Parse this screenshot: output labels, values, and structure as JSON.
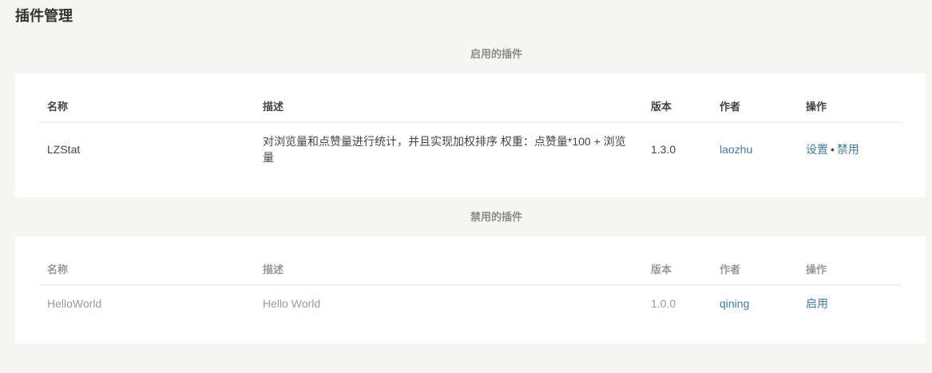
{
  "page_title": "插件管理",
  "enabled_section": {
    "title": "启用的插件",
    "headers": {
      "name": "名称",
      "desc": "描述",
      "version": "版本",
      "author": "作者",
      "actions": "操作"
    },
    "rows": [
      {
        "name": "LZStat",
        "desc": "对浏览量和点赞量进行统计，并且实现加权排序 权重：点赞量*100 + 浏览量",
        "version": "1.3.0",
        "author": "laozhu",
        "action_settings": "设置",
        "action_separator": "•",
        "action_disable": "禁用"
      }
    ]
  },
  "disabled_section": {
    "title": "禁用的插件",
    "headers": {
      "name": "名称",
      "desc": "描述",
      "version": "版本",
      "author": "作者",
      "actions": "操作"
    },
    "rows": [
      {
        "name": "HelloWorld",
        "desc": "Hello World",
        "version": "1.0.0",
        "author": "qining",
        "action_enable": "启用"
      }
    ]
  },
  "colors": {
    "background": "#f5f5f1",
    "panel": "#ffffff",
    "link": "#467b96",
    "muted_text": "#999999"
  }
}
